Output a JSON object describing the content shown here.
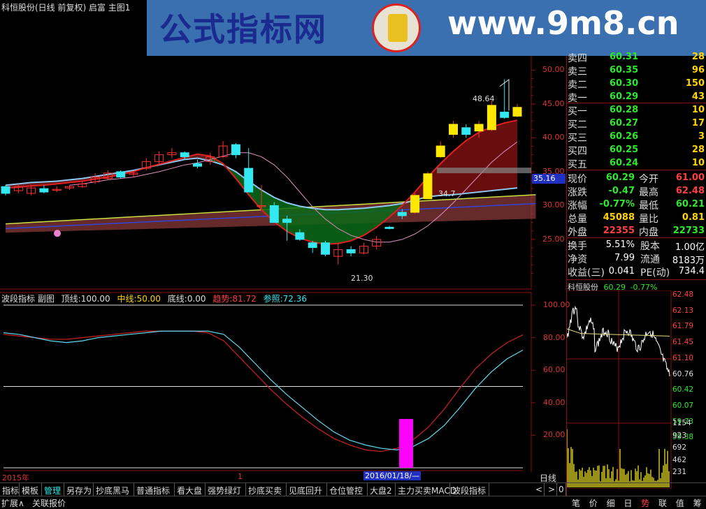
{
  "title_bar": {
    "stock_info": "科恒股份(日线 前复权) 启富 主图1"
  },
  "watermark": {
    "site_name": "公式指标网",
    "url": "www.9m8.cn"
  },
  "main_chart": {
    "price_axis": [
      "50.00",
      "45.00",
      "40.00",
      "35.00",
      "30.00",
      "25.00"
    ],
    "current_price_tag": "35.16",
    "label_high": "48.64",
    "label_low": "21.30",
    "label_mid": "34.7"
  },
  "indicator_header": {
    "name": "波段指标 副图",
    "top_label": "顶线:",
    "top_value": "100.00",
    "mid_label": "中线:",
    "mid_value": "50.00",
    "bottom_label": "底线:",
    "bottom_value": "0.00",
    "trend_label": "趋势:",
    "trend_value": "81.72",
    "ref_label": "参照:",
    "ref_value": "72.36"
  },
  "indicator_axis": [
    "100.00",
    "80.00",
    "60.00",
    "40.00",
    "20.00"
  ],
  "date_axis": {
    "year_label": "2015年",
    "month_label": "1",
    "cursor_date": "2016/01/18/—",
    "period_label": "日线"
  },
  "order_book": {
    "sell": [
      {
        "label": "卖四",
        "price": "60.31",
        "vol": "28"
      },
      {
        "label": "卖三",
        "price": "60.35",
        "vol": "96"
      },
      {
        "label": "卖二",
        "price": "60.30",
        "vol": "150"
      },
      {
        "label": "卖一",
        "price": "60.29",
        "vol": "43"
      }
    ],
    "buy": [
      {
        "label": "买一",
        "price": "60.28",
        "vol": "10"
      },
      {
        "label": "买二",
        "price": "60.27",
        "vol": "17"
      },
      {
        "label": "买三",
        "price": "60.26",
        "vol": "3"
      },
      {
        "label": "买四",
        "price": "60.25",
        "vol": "28"
      },
      {
        "label": "买五",
        "price": "60.24",
        "vol": "10"
      }
    ]
  },
  "quote": [
    {
      "l1": "现价",
      "v1": "60.29",
      "l2": "今开",
      "v2": "61.00"
    },
    {
      "l1": "涨跌",
      "v1": "-0.47",
      "l2": "最高",
      "v2": "62.48"
    },
    {
      "l1": "涨幅",
      "v1": "-0.77%",
      "l2": "最低",
      "v2": "60.21"
    },
    {
      "l1": "总量",
      "v1": "45088",
      "l2": "量比",
      "v2": "0.81"
    },
    {
      "l1": "外盘",
      "v1": "22355",
      "l2": "内盘",
      "v2": "22733"
    }
  ],
  "fundamentals": [
    {
      "l1": "换手",
      "v1": "5.51%",
      "l2": "股本",
      "v2": "1.00亿"
    },
    {
      "l1": "净资",
      "v1": "7.99",
      "l2": "流通",
      "v2": "8183万"
    },
    {
      "l1": "收益(三)",
      "v1": "0.041",
      "l2": "PE(动)",
      "v2": "734.4"
    }
  ],
  "mini_chart": {
    "name": "科恒股份",
    "price": "60.29",
    "change": "-0.77%",
    "price_axis": [
      "62.48",
      "62.13",
      "61.79",
      "61.45",
      "61.10",
      "60.76",
      "60.42",
      "60.07",
      "59.73",
      "59.38"
    ],
    "vol_axis": [
      "1154",
      "923",
      "692",
      "462",
      "231"
    ]
  },
  "tabs": [
    "指标",
    "模板",
    "管理",
    "另存为",
    "抄底黑马",
    "普通指标",
    "看大盘",
    "强势绿灯",
    "抄底买卖",
    "见底回升",
    "仓位管控",
    "大盘2",
    "主力买卖MACD",
    "波段指标"
  ],
  "tab_scroll": [
    "<",
    ">"
  ],
  "tab_counter": "0",
  "bottom_left": [
    "扩展∧",
    "关联报价"
  ],
  "bottom_right": [
    "笔",
    "价",
    "细",
    "日",
    "势",
    "联",
    "值",
    "筹"
  ],
  "colors": {
    "up": "#ff3030",
    "down": "#33e8f0",
    "bg": "#000000",
    "grid": "#8a1010"
  },
  "chart_data": [
    {
      "type": "candlestick",
      "title": "科恒股份(日线 前复权)",
      "ylim": [
        20,
        52
      ],
      "candles": [
        {
          "o": 32.8,
          "c": 31.8,
          "h": 33.0,
          "l": 31.5
        },
        {
          "o": 32.2,
          "c": 32.8,
          "h": 33.2,
          "l": 31.8
        },
        {
          "o": 31.8,
          "c": 32.6,
          "h": 33.0,
          "l": 31.5
        },
        {
          "o": 32.5,
          "c": 32.0,
          "h": 33.0,
          "l": 31.8
        },
        {
          "o": 32.3,
          "c": 32.4,
          "h": 32.8,
          "l": 32.0
        },
        {
          "o": 32.6,
          "c": 32.8,
          "h": 33.0,
          "l": 32.3
        },
        {
          "o": 32.8,
          "c": 33.2,
          "h": 33.5,
          "l": 32.6
        },
        {
          "o": 33.5,
          "c": 34.2,
          "h": 34.8,
          "l": 33.2
        },
        {
          "o": 34.0,
          "c": 34.8,
          "h": 35.2,
          "l": 33.8
        },
        {
          "o": 35.0,
          "c": 34.2,
          "h": 35.2,
          "l": 34.0
        },
        {
          "o": 34.6,
          "c": 34.8,
          "h": 35.0,
          "l": 34.2
        },
        {
          "o": 35.5,
          "c": 36.5,
          "h": 37.0,
          "l": 35.2
        },
        {
          "o": 36.5,
          "c": 37.5,
          "h": 38.0,
          "l": 36.2
        },
        {
          "o": 37.5,
          "c": 37.8,
          "h": 38.5,
          "l": 37.0
        },
        {
          "o": 37.8,
          "c": 37.2,
          "h": 38.0,
          "l": 36.8
        },
        {
          "o": 36.2,
          "c": 35.8,
          "h": 36.8,
          "l": 35.5
        },
        {
          "o": 36.5,
          "c": 37.2,
          "h": 37.8,
          "l": 36.0
        },
        {
          "o": 37.2,
          "c": 38.8,
          "h": 39.5,
          "l": 37.0
        },
        {
          "o": 39.0,
          "c": 37.5,
          "h": 39.2,
          "l": 37.0
        },
        {
          "o": 35.5,
          "c": 32.0,
          "h": 38.5,
          "l": 32.0
        },
        {
          "o": 30.0,
          "c": 30.0,
          "h": 33.0,
          "l": 29.5
        },
        {
          "o": 30.0,
          "c": 27.5,
          "h": 30.5,
          "l": 27.5
        },
        {
          "o": 28.0,
          "c": 27.5,
          "h": 28.5,
          "l": 24.8
        },
        {
          "o": 26.0,
          "c": 25.0,
          "h": 26.5,
          "l": 24.8
        },
        {
          "o": 24.5,
          "c": 23.8,
          "h": 24.8,
          "l": 23.0
        },
        {
          "o": 24.5,
          "c": 22.8,
          "h": 24.8,
          "l": 22.5
        },
        {
          "o": 22.5,
          "c": 23.5,
          "h": 24.5,
          "l": 21.3
        },
        {
          "o": 23.5,
          "c": 23.0,
          "h": 24.0,
          "l": 22.5
        },
        {
          "o": 23.0,
          "c": 24.0,
          "h": 24.5,
          "l": 22.8
        },
        {
          "o": 24.0,
          "c": 25.0,
          "h": 25.5,
          "l": 23.5
        },
        {
          "o": 26.8,
          "c": 26.6,
          "h": 27.0,
          "l": 26.5
        },
        {
          "o": 29.0,
          "c": 28.5,
          "h": 29.5,
          "l": 28.0
        },
        {
          "o": 29.0,
          "c": 31.5,
          "h": 31.8,
          "l": 28.8
        },
        {
          "o": 31.0,
          "c": 34.7,
          "h": 35.0,
          "l": 31.0
        },
        {
          "o": 37.2,
          "c": 38.8,
          "h": 39.5,
          "l": 37.0
        },
        {
          "o": 40.5,
          "c": 42.0,
          "h": 42.5,
          "l": 40.0
        },
        {
          "o": 41.5,
          "c": 40.5,
          "h": 42.0,
          "l": 40.0
        },
        {
          "o": 41.0,
          "c": 42.0,
          "h": 42.5,
          "l": 40.0
        },
        {
          "o": 41.2,
          "c": 44.8,
          "h": 45.5,
          "l": 41.0
        },
        {
          "o": 43.8,
          "c": 43.0,
          "h": 48.64,
          "l": 42.8
        },
        {
          "o": 43.2,
          "c": 44.5,
          "h": 45.0,
          "l": 43.0
        }
      ]
    },
    {
      "type": "line",
      "title": "波段指标",
      "ylim": [
        0,
        110
      ],
      "series": [
        {
          "name": "趋势",
          "values": [
            82,
            81,
            80,
            79,
            79,
            80,
            81,
            82,
            83,
            84,
            84,
            84,
            84,
            83,
            78,
            68,
            58,
            48,
            39,
            31,
            24,
            18,
            14,
            11,
            10,
            12,
            17,
            25,
            36,
            49,
            61,
            70,
            77,
            81.72
          ]
        },
        {
          "name": "参照",
          "values": [
            83,
            82,
            80,
            78,
            77,
            78,
            80,
            81,
            82,
            83,
            84,
            84,
            84,
            84,
            82,
            74,
            64,
            54,
            45,
            37,
            29,
            22,
            17,
            14,
            12,
            11,
            13,
            18,
            26,
            37,
            49,
            59,
            67,
            72.36
          ]
        }
      ]
    }
  ]
}
